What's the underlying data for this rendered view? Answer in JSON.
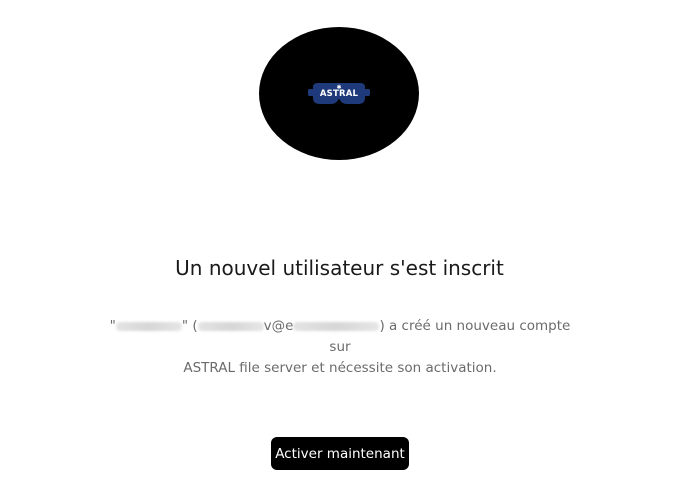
{
  "logo": {
    "text": "ASTRAL",
    "icon": "goggles-logo-icon",
    "background": "#000000",
    "accent": "#1f3a7a"
  },
  "title": "Un nouvel utilisateur s'est inscrit",
  "message": {
    "quote_open": "\"",
    "quote_close": "\" (",
    "email_mid": "v@e",
    "suffix_line1": ") a créé un nouveau compte sur",
    "line2": "ASTRAL file server et nécessite son activation."
  },
  "cta": {
    "label": "Activer maintenant",
    "background": "#000000"
  }
}
